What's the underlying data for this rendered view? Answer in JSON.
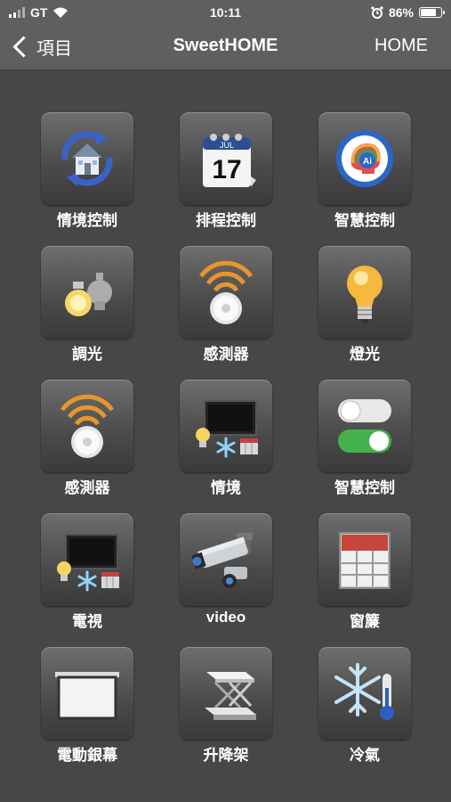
{
  "status_bar": {
    "carrier": "GT",
    "time": "10:11",
    "battery": "86%",
    "battery_level": 0.86,
    "icons": [
      "signal-icon",
      "wifi-icon",
      "alarm-icon",
      "battery-icon"
    ]
  },
  "nav": {
    "back_label": "項目",
    "title": "SweetHOME",
    "right_label": "HOME"
  },
  "tiles": [
    {
      "label": "情境控制",
      "icon": "scene-home-icon"
    },
    {
      "label": "排程控制",
      "icon": "calendar-icon",
      "calendar_month": "JUL",
      "calendar_day": "17"
    },
    {
      "label": "智慧控制",
      "icon": "ai-brain-icon",
      "badge": "Ai"
    },
    {
      "label": "調光",
      "icon": "dimmer-bulbs-icon"
    },
    {
      "label": "感測器",
      "icon": "sensor-icon"
    },
    {
      "label": "燈光",
      "icon": "lightbulb-icon"
    },
    {
      "label": "感測器",
      "icon": "sensor-icon"
    },
    {
      "label": "情境",
      "icon": "scene-tv-icon"
    },
    {
      "label": "智慧控制",
      "icon": "toggle-switches-icon"
    },
    {
      "label": "電視",
      "icon": "tv-icon"
    },
    {
      "label": "video",
      "icon": "cctv-camera-icon"
    },
    {
      "label": "窗簾",
      "icon": "curtain-icon"
    },
    {
      "label": "電動銀幕",
      "icon": "projector-screen-icon"
    },
    {
      "label": "升降架",
      "icon": "lift-icon"
    },
    {
      "label": "冷氣",
      "icon": "ac-snowflake-icon"
    }
  ]
}
